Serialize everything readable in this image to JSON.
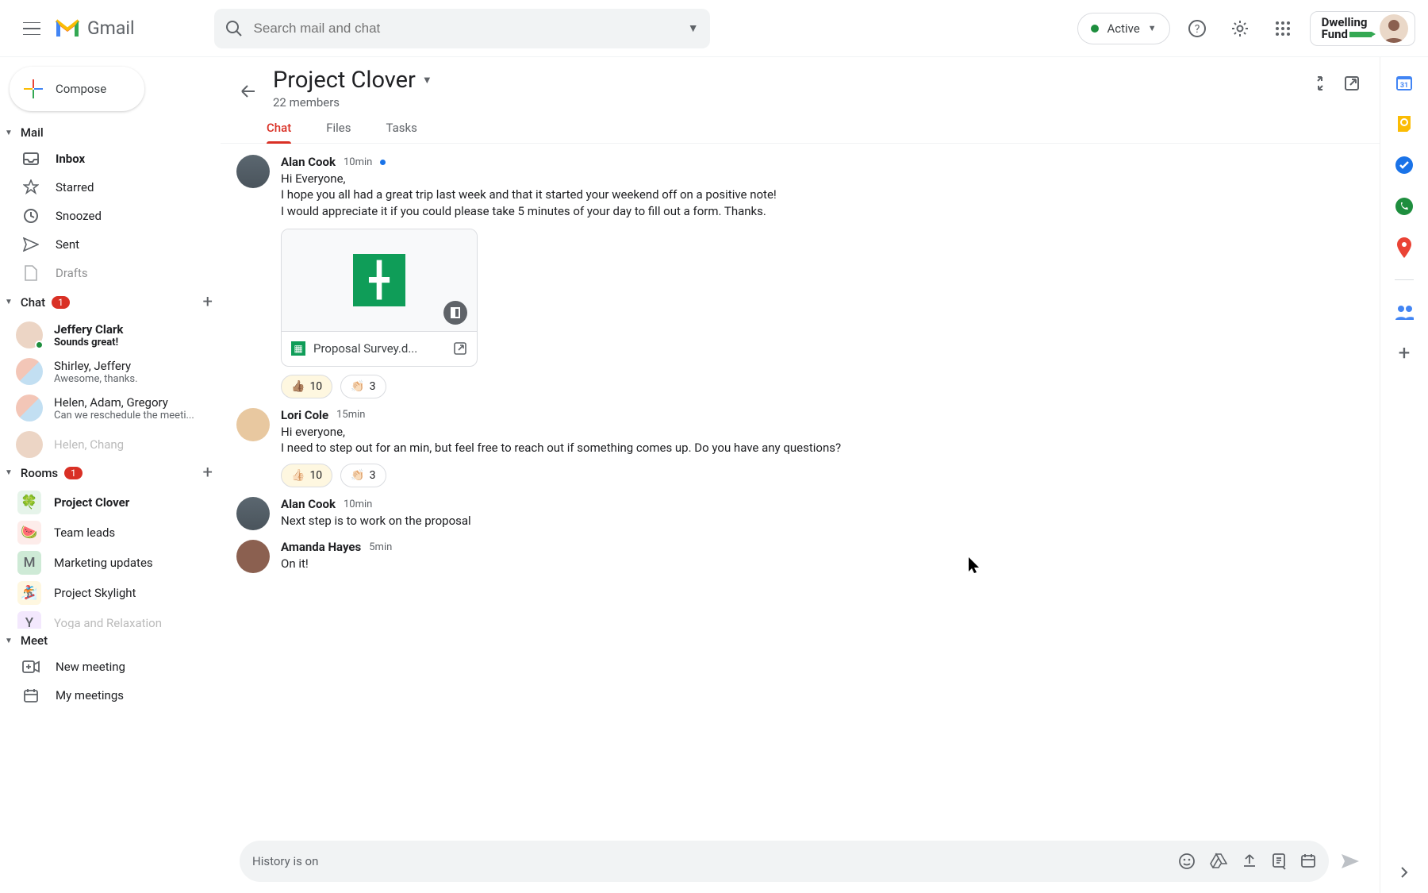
{
  "header": {
    "app_name": "Gmail",
    "search_placeholder": "Search mail and chat",
    "status_label": "Active",
    "org_line1": "Dwelling",
    "org_line2": "Fund"
  },
  "compose": {
    "label": "Compose"
  },
  "sections": {
    "mail": {
      "label": "Mail",
      "items": [
        "Inbox",
        "Starred",
        "Snoozed",
        "Sent",
        "Drafts"
      ]
    },
    "chat": {
      "label": "Chat",
      "badge": "1",
      "items": [
        {
          "name": "Jeffery Clark",
          "preview": "Sounds great!",
          "online": true,
          "bold": true
        },
        {
          "name": "Shirley, Jeffery",
          "preview": "Awesome, thanks.",
          "group": true
        },
        {
          "name": "Helen, Adam, Gregory",
          "preview": "Can we reschedule the meeti...",
          "group": true
        },
        {
          "name": "Helen, Chang",
          "preview": "",
          "truncated": true
        }
      ]
    },
    "rooms": {
      "label": "Rooms",
      "badge": "1",
      "items": [
        {
          "emoji": "🍀",
          "name": "Project Clover",
          "bold": true,
          "bg": "#e6f4ea"
        },
        {
          "emoji": "🍉",
          "name": "Team leads",
          "bg": "#fdecea"
        },
        {
          "emoji": "M",
          "name": "Marketing updates",
          "bg": "#ceead6",
          "letter": true
        },
        {
          "emoji": "🏂",
          "name": "Project Skylight",
          "bg": "#fef7e0"
        },
        {
          "emoji": "Y",
          "name": "Yoga and Relaxation",
          "bg": "#f3e8fd",
          "letter": true,
          "truncated": true
        }
      ]
    },
    "meet": {
      "label": "Meet",
      "items": [
        "New meeting",
        "My meetings"
      ]
    }
  },
  "room": {
    "title": "Project Clover",
    "subtitle": "22 members",
    "tabs": [
      "Chat",
      "Files",
      "Tasks"
    ],
    "messages": [
      {
        "author": "Alan Cook",
        "ts": "10min",
        "unread": true,
        "lines": [
          "Hi Everyone,",
          "I hope you all had a great trip last week and that it started your weekend off on a positive note!",
          "I would appreciate it if you could please take 5 minutes of your day to fill out a form. Thanks."
        ],
        "attachment": {
          "filename": "Proposal Survey.d..."
        },
        "reactions": [
          {
            "emoji": "👍🏽",
            "count": "10",
            "sel": true
          },
          {
            "emoji": "👏🏻",
            "count": "3"
          }
        ]
      },
      {
        "author": "Lori Cole",
        "ts": "15min",
        "lines": [
          "Hi everyone,",
          "I need to step out for an min, but feel free to reach out if something comes up.  Do you have any questions?"
        ],
        "reactions": [
          {
            "emoji": "👍🏻",
            "count": "10",
            "sel": true
          },
          {
            "emoji": "👏🏻",
            "count": "3"
          }
        ]
      },
      {
        "author": "Alan Cook",
        "ts": "10min",
        "lines": [
          "Next step is to work on the proposal"
        ]
      },
      {
        "author": "Amanda Hayes",
        "ts": "5min",
        "lines": [
          "On it!"
        ]
      }
    ],
    "composer_placeholder": "History is on"
  }
}
